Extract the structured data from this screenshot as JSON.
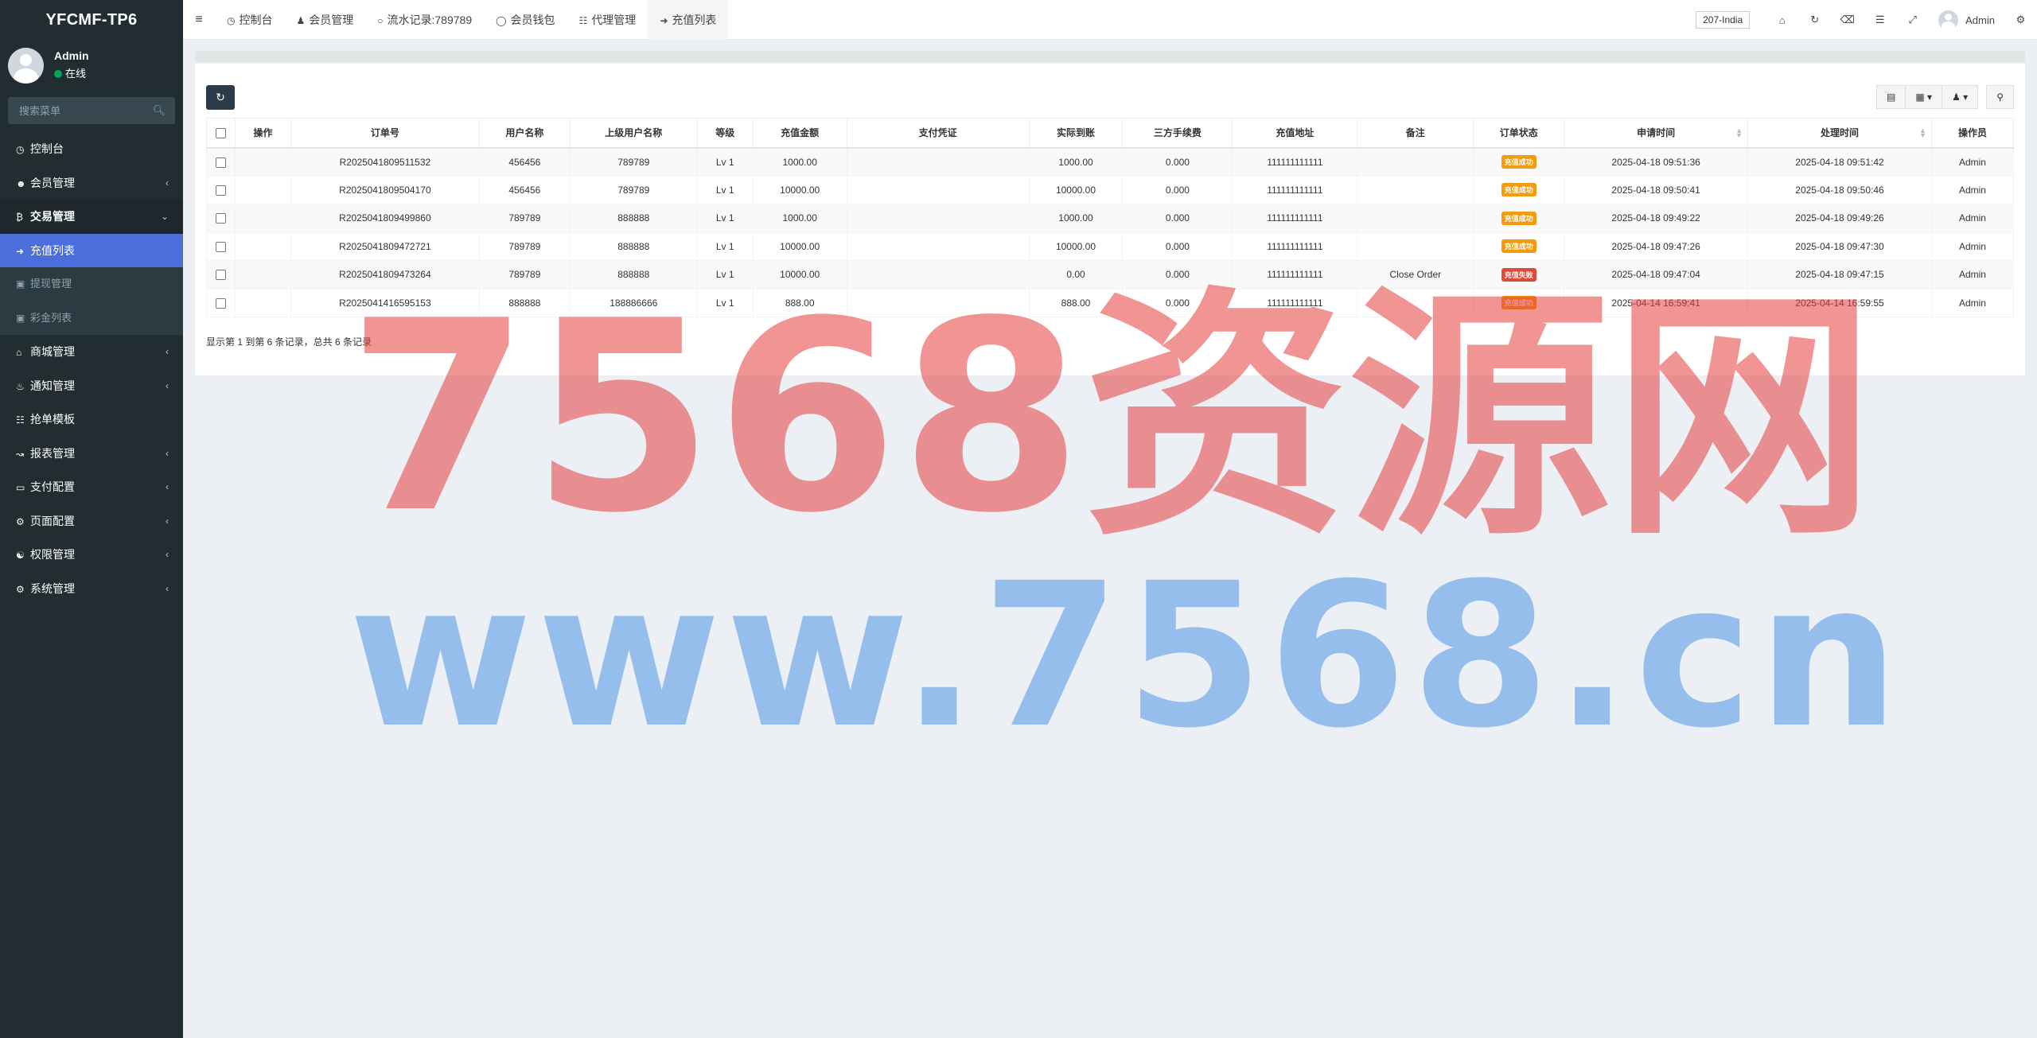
{
  "app": {
    "logo": "YFCMF-TP6"
  },
  "user_panel": {
    "name": "Admin",
    "status": "在线"
  },
  "sidebar": {
    "search_placeholder": "搜索菜单",
    "items": [
      {
        "label": "控制台",
        "icon": "dashboard-icon"
      },
      {
        "label": "会员管理",
        "icon": "user-circle-icon"
      },
      {
        "label": "交易管理",
        "icon": "bitcoin-icon"
      },
      {
        "label": "充值列表",
        "icon": "sign-in-icon"
      },
      {
        "label": "提现管理",
        "icon": "gift-icon"
      },
      {
        "label": "彩金列表",
        "icon": "gift-icon"
      },
      {
        "label": "商城管理",
        "icon": "home-icon"
      },
      {
        "label": "通知管理",
        "icon": "bell-icon"
      },
      {
        "label": "抢单模板",
        "icon": "sitemap-icon"
      },
      {
        "label": "报表管理",
        "icon": "chart-icon"
      },
      {
        "label": "支付配置",
        "icon": "credit-card-icon"
      },
      {
        "label": "页面配置",
        "icon": "gear-icon"
      },
      {
        "label": "权限管理",
        "icon": "users-icon"
      },
      {
        "label": "系统管理",
        "icon": "cogs-icon"
      }
    ]
  },
  "topbar": {
    "tabs": [
      {
        "label": "控制台",
        "icon": "dashboard-icon"
      },
      {
        "label": "会员管理",
        "icon": "user-icon"
      },
      {
        "label": "流水记录:789789",
        "icon": "circle-icon"
      },
      {
        "label": "会员钱包",
        "icon": "dollar-circle-icon"
      },
      {
        "label": "代理管理",
        "icon": "sitemap-icon"
      },
      {
        "label": "充值列表",
        "icon": "sign-in-icon"
      }
    ],
    "lang": "207-India",
    "user": "Admin"
  },
  "table": {
    "headers": [
      "操作",
      "订单号",
      "用户名称",
      "上级用户名称",
      "等级",
      "充值金额",
      "支付凭证",
      "实际到账",
      "三方手续费",
      "充值地址",
      "备注",
      "订单状态",
      "申请时间",
      "处理时间",
      "操作员"
    ],
    "rows": [
      {
        "order": "R2025041809511532",
        "user": "456456",
        "parent": "789789",
        "level": "Lv 1",
        "amount": "1000.00",
        "proof": "",
        "actual": "1000.00",
        "fee": "0.000",
        "address": "111111111111",
        "remark": "",
        "status": "充值成功",
        "apply": "2025-04-18 09:51:36",
        "process": "2025-04-18 09:51:42",
        "operator": "Admin"
      },
      {
        "order": "R2025041809504170",
        "user": "456456",
        "parent": "789789",
        "level": "Lv 1",
        "amount": "10000.00",
        "proof": "",
        "actual": "10000.00",
        "fee": "0.000",
        "address": "111111111111",
        "remark": "",
        "status": "充值成功",
        "apply": "2025-04-18 09:50:41",
        "process": "2025-04-18 09:50:46",
        "operator": "Admin"
      },
      {
        "order": "R2025041809499860",
        "user": "789789",
        "parent": "888888",
        "level": "Lv 1",
        "amount": "1000.00",
        "proof": "",
        "actual": "1000.00",
        "fee": "0.000",
        "address": "111111111111",
        "remark": "",
        "status": "充值成功",
        "apply": "2025-04-18 09:49:22",
        "process": "2025-04-18 09:49:26",
        "operator": "Admin"
      },
      {
        "order": "R2025041809472721",
        "user": "789789",
        "parent": "888888",
        "level": "Lv 1",
        "amount": "10000.00",
        "proof": "",
        "actual": "10000.00",
        "fee": "0.000",
        "address": "111111111111",
        "remark": "",
        "status": "充值成功",
        "apply": "2025-04-18 09:47:26",
        "process": "2025-04-18 09:47:30",
        "operator": "Admin"
      },
      {
        "order": "R2025041809473264",
        "user": "789789",
        "parent": "888888",
        "level": "Lv 1",
        "amount": "10000.00",
        "proof": "",
        "actual": "0.00",
        "fee": "0.000",
        "address": "111111111111",
        "remark": "Close Order",
        "status": "充值失败",
        "apply": "2025-04-18 09:47:04",
        "process": "2025-04-18 09:47:15",
        "operator": "Admin"
      },
      {
        "order": "R2025041416595153",
        "user": "888888",
        "parent": "188886666",
        "level": "Lv 1",
        "amount": "888.00",
        "proof": "",
        "actual": "888.00",
        "fee": "0.000",
        "address": "111111111111",
        "remark": "",
        "status": "充值成功",
        "apply": "2025-04-14 16:59:41",
        "process": "2025-04-14 16:59:55",
        "operator": "Admin"
      }
    ],
    "summary": "显示第 1 到第 6 条记录，总共 6 条记录"
  },
  "colors": {
    "success": "#f39c12",
    "failed": "#dd4b39",
    "sidebar": "#222d32",
    "active": "#4a6fdc"
  },
  "watermark": {
    "line1": "7568资源网",
    "line2": "www.7568.cn"
  }
}
